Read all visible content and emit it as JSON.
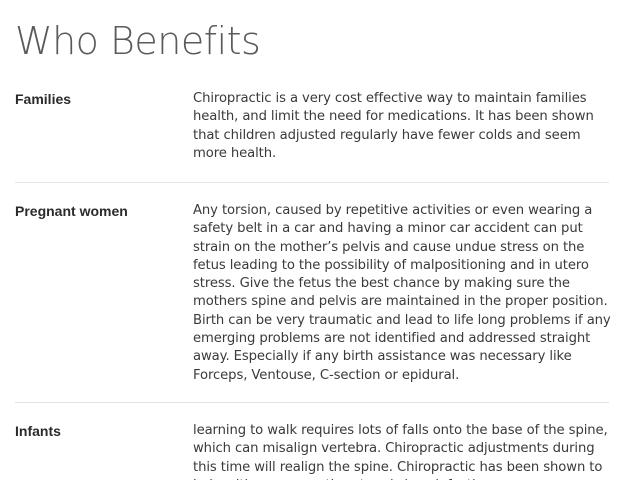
{
  "page": {
    "title": "Who Benefits"
  },
  "benefits": [
    {
      "label": "Families",
      "text": "Chiropractic is a very cost effective way to maintain families health, and limit the need for medications. It has been shown that children adjusted regularly have fewer colds and seem more health."
    },
    {
      "label": "Pregnant women",
      "text": "Any torsion, caused by repetitive activities or even wearing a safety belt in a car and having a minor car accident can put strain on the mother’s pelvis and cause undue stress on the fetus leading to the possibility of malpositioning and in utero stress. Give the fetus the best chance by making sure the mothers spine and pelvis are maintained in the proper position. Birth can be very traumatic and lead to life long problems if any emerging problems are not identified and addressed straight away. Especially if any birth assistance was necessary like Forceps, Ventouse, C-section or epidural."
    },
    {
      "label": "Infants",
      "text": "learning to walk requires lots of falls onto the base of the spine, which can misalign vertebra. Chiropractic adjustments during this time will realign the spine. Chiropractic has been shown to help with ear, nose, throat and sinus infections."
    }
  ]
}
